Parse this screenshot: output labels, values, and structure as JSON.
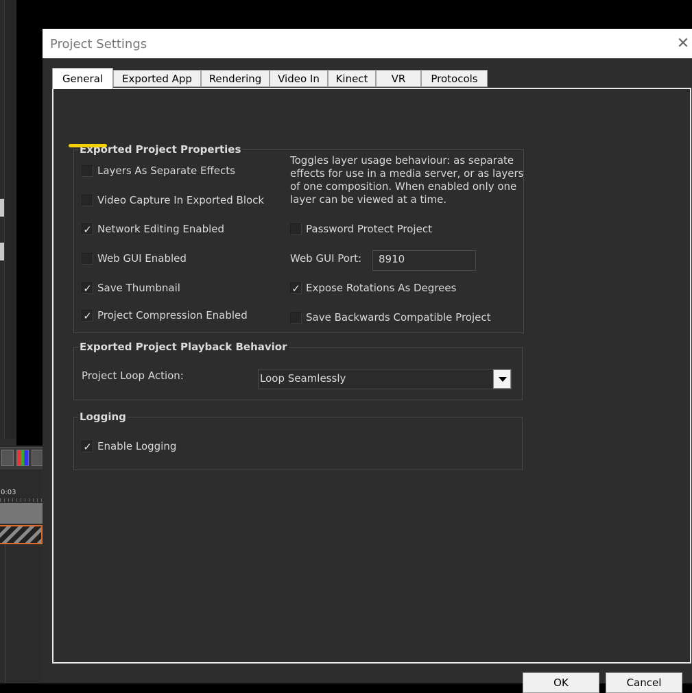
{
  "background_app": {
    "timecode": "0:03"
  },
  "dialog": {
    "title": "Project Settings",
    "close_glyph": "✕",
    "tabs": [
      "General",
      "Exported App",
      "Rendering",
      "Video In",
      "Kinect",
      "VR",
      "Protocols"
    ],
    "active_tab": "General",
    "exported_properties": {
      "title": "Exported Project Properties",
      "description": "Toggles layer usage behaviour: as separate effects for use in a media server, or as layers of one composition. When enabled only one layer can be viewed at a time.",
      "checkboxes": [
        {
          "label": "Layers As Separate Effects",
          "checked": false
        },
        {
          "label": "Video Capture In Exported Block",
          "checked": false
        },
        {
          "label": "Network Editing Enabled",
          "checked": true
        },
        {
          "label": "Web GUI Enabled",
          "checked": false
        },
        {
          "label": "Save Thumbnail",
          "checked": true
        },
        {
          "label": "Project Compression Enabled",
          "checked": true
        },
        {
          "label": "Password Protect Project",
          "checked": false
        },
        {
          "label": "Expose Rotations As Degrees",
          "checked": true
        },
        {
          "label": "Save Backwards Compatible Project",
          "checked": false
        }
      ],
      "web_gui_port_label": "Web GUI Port:",
      "web_gui_port_value": "8910"
    },
    "playback": {
      "title": "Exported Project Playback Behavior",
      "loop_label": "Project Loop Action:",
      "loop_value": "Loop Seamlessly"
    },
    "logging": {
      "title": "Logging",
      "enable_label": "Enable Logging",
      "enable_checked": true
    },
    "buttons": {
      "ok": "OK",
      "cancel": "Cancel"
    },
    "highlight_color": "#f5d000"
  }
}
